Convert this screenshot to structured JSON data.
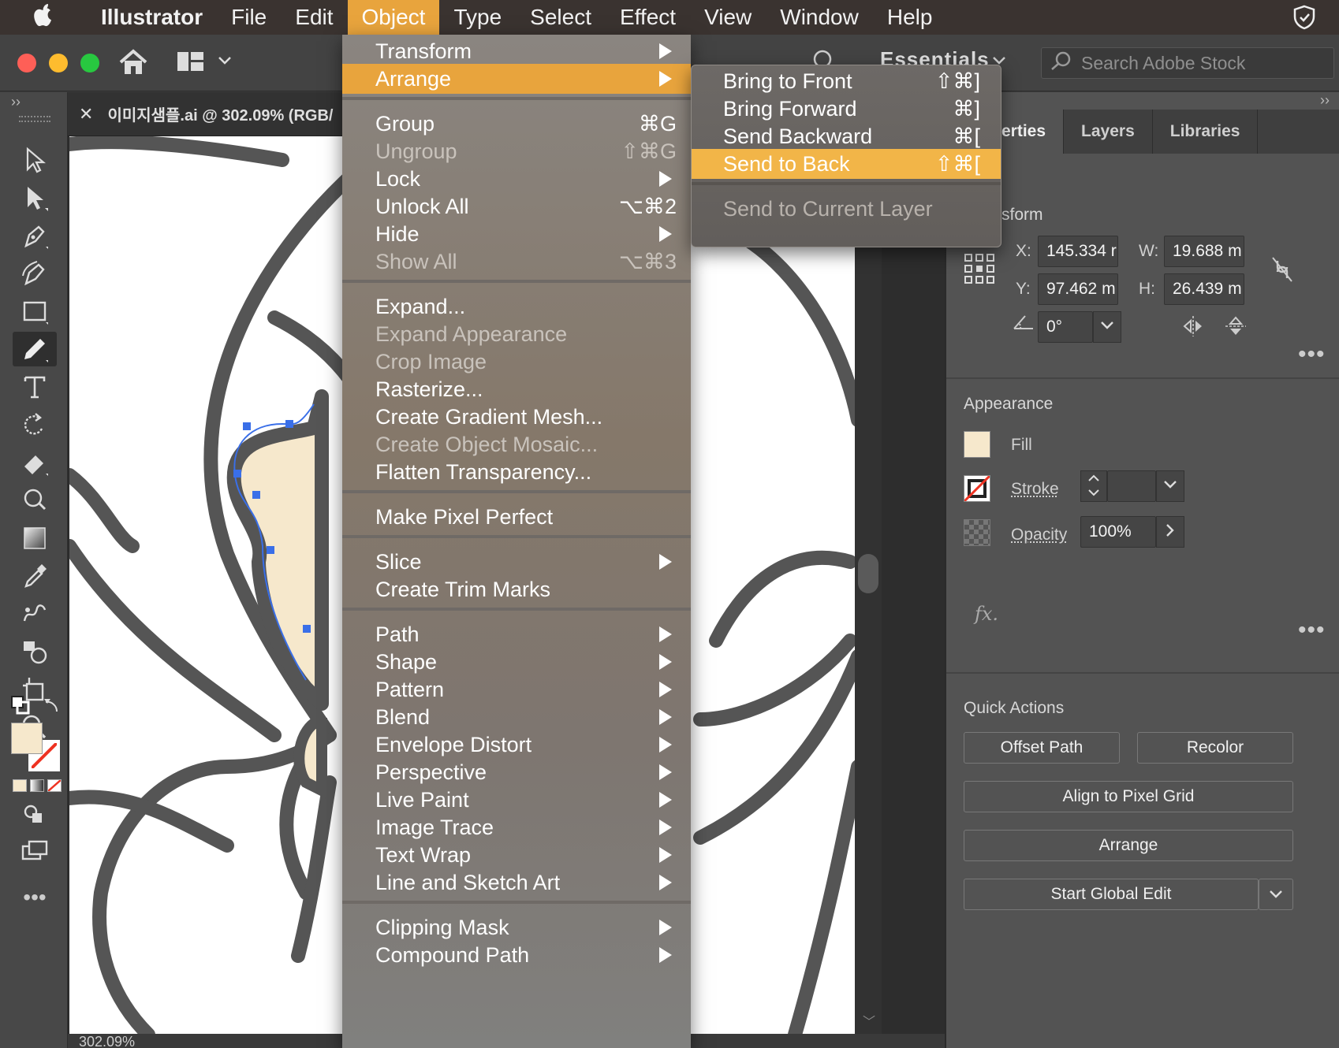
{
  "menubar": {
    "app": "Illustrator",
    "items": [
      "File",
      "Edit",
      "Object",
      "Type",
      "Select",
      "Effect",
      "View",
      "Window",
      "Help"
    ],
    "active": "Object"
  },
  "toolbar": {
    "workspace": "Essentials",
    "search_placeholder": "Search Adobe Stock"
  },
  "document": {
    "tab_title": "이미지샘플.ai @ 302.09% (RGB/",
    "zoom": "302.09%"
  },
  "object_menu": {
    "sections": [
      [
        {
          "label": "Transform",
          "submenu": true,
          "disabled": false
        },
        {
          "label": "Arrange",
          "submenu": true,
          "disabled": false,
          "highlighted": true
        }
      ],
      [
        {
          "label": "Group",
          "shortcut": "⌘G",
          "disabled": false
        },
        {
          "label": "Ungroup",
          "shortcut": "⇧⌘G",
          "disabled": true
        },
        {
          "label": "Lock",
          "submenu": true,
          "disabled": false
        },
        {
          "label": "Unlock All",
          "shortcut": "⌥⌘2",
          "disabled": false
        },
        {
          "label": "Hide",
          "submenu": true,
          "disabled": false
        },
        {
          "label": "Show All",
          "shortcut": "⌥⌘3",
          "disabled": true
        }
      ],
      [
        {
          "label": "Expand...",
          "disabled": false
        },
        {
          "label": "Expand Appearance",
          "disabled": true
        },
        {
          "label": "Crop Image",
          "disabled": true
        },
        {
          "label": "Rasterize...",
          "disabled": false
        },
        {
          "label": "Create Gradient Mesh...",
          "disabled": false
        },
        {
          "label": "Create Object Mosaic...",
          "disabled": true
        },
        {
          "label": "Flatten Transparency...",
          "disabled": false
        }
      ],
      [
        {
          "label": "Make Pixel Perfect",
          "disabled": false
        }
      ],
      [
        {
          "label": "Slice",
          "submenu": true,
          "disabled": false
        },
        {
          "label": "Create Trim Marks",
          "disabled": false
        }
      ],
      [
        {
          "label": "Path",
          "submenu": true,
          "disabled": false
        },
        {
          "label": "Shape",
          "submenu": true,
          "disabled": false
        },
        {
          "label": "Pattern",
          "submenu": true,
          "disabled": false
        },
        {
          "label": "Blend",
          "submenu": true,
          "disabled": false
        },
        {
          "label": "Envelope Distort",
          "submenu": true,
          "disabled": false
        },
        {
          "label": "Perspective",
          "submenu": true,
          "disabled": false
        },
        {
          "label": "Live Paint",
          "submenu": true,
          "disabled": false
        },
        {
          "label": "Image Trace",
          "submenu": true,
          "disabled": false
        },
        {
          "label": "Text Wrap",
          "submenu": true,
          "disabled": false
        },
        {
          "label": "Line and Sketch Art",
          "submenu": true,
          "disabled": false
        }
      ],
      [
        {
          "label": "Clipping Mask",
          "submenu": true,
          "disabled": false
        },
        {
          "label": "Compound Path",
          "submenu": true,
          "disabled": false
        }
      ]
    ]
  },
  "arrange_submenu": {
    "sections": [
      [
        {
          "label": "Bring to Front",
          "shortcut": "⇧⌘]",
          "disabled": false
        },
        {
          "label": "Bring Forward",
          "shortcut": "⌘]",
          "disabled": false
        },
        {
          "label": "Send Backward",
          "shortcut": "⌘[",
          "disabled": false
        },
        {
          "label": "Send to Back",
          "shortcut": "⇧⌘[",
          "disabled": false,
          "highlighted": true
        }
      ],
      [
        {
          "label": "Send to Current Layer",
          "disabled": true
        }
      ]
    ]
  },
  "panel": {
    "tabs": [
      "erties",
      "Layers",
      "Libraries"
    ],
    "transform": {
      "title": "sform",
      "x_label": "X:",
      "x": "145.334 r",
      "y_label": "Y:",
      "y": "97.462 m",
      "w_label": "W:",
      "w": "19.688 m",
      "h_label": "H:",
      "h": "26.439 m",
      "angle": "0°"
    },
    "appearance": {
      "title": "Appearance",
      "fill_label": "Fill",
      "stroke_label": "Stroke",
      "opacity_label": "Opacity",
      "opacity": "100%",
      "fx": "fx."
    },
    "quick_actions": {
      "title": "Quick Actions",
      "buttons": [
        "Offset Path",
        "Recolor",
        "Align to Pixel Grid",
        "Arrange",
        "Start Global Edit"
      ]
    }
  },
  "colors": {
    "accent": "#e8a43d",
    "fill_swatch": "#f6e8cc",
    "selection": "#3a6fe8",
    "stroke_art": "#555555"
  }
}
